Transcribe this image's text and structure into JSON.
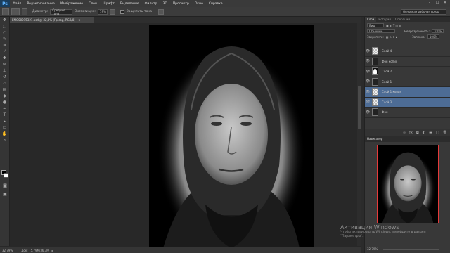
{
  "menubar": {
    "logo": "Ps",
    "items": [
      "Файл",
      "Редактирование",
      "Изображение",
      "Слои",
      "Шрифт",
      "Выделение",
      "Фильтр",
      "3D",
      "Просмотр",
      "Окно",
      "Справка"
    ],
    "controls": [
      "–",
      "☐",
      "✕"
    ]
  },
  "options": {
    "diameter_label": "Диаметр:",
    "smooth_label": "Сглаж.",
    "mode_value": "Средние тона",
    "exposure_label": "Экспозиция:",
    "exposure_value": "19%",
    "protect_label": "Защитить тона",
    "workspace": "Основная рабочая среда"
  },
  "document": {
    "tab_title": "EMG00015321.psd @ 32,8% (Гр.сор, RGB/8)",
    "tab_close": "×"
  },
  "status": {
    "zoom": "32,79%",
    "doc_label": "Док:",
    "doc_size": "5,79M/36,7M"
  },
  "layers": {
    "tabs": [
      "Слои",
      "История",
      "Операции"
    ],
    "kind_label": "Вид",
    "blend_mode": "Обычные",
    "opacity_label": "Непрозрачность:",
    "opacity_value": "100%",
    "lock_label": "Закрепить:",
    "fill_label": "Заливка:",
    "fill_value": "100%",
    "items": [
      {
        "name": "Слой 4",
        "thumb": "checker",
        "selected": false
      },
      {
        "name": "Фон копия",
        "thumb": "dark",
        "selected": false
      },
      {
        "name": "Слой 2",
        "thumb": "mask",
        "selected": false
      },
      {
        "name": "Слой 1",
        "thumb": "dark",
        "selected": false
      },
      {
        "name": "Слой 1 копия",
        "thumb": "checker",
        "selected": true
      },
      {
        "name": "Слой 3",
        "thumb": "checker",
        "selected": true
      },
      {
        "name": "Фон",
        "thumb": "dark",
        "selected": false
      }
    ],
    "footer_icons": [
      "link",
      "fx",
      "mask",
      "adjust",
      "folder",
      "new",
      "trash"
    ]
  },
  "navigator": {
    "title": "Навигатор",
    "zoom": "32,79%",
    "box_color": "#e53a3a"
  },
  "watermark": {
    "title": "Активация Windows",
    "line1": "Чтобы активировать Windows, перейдите в раздел",
    "line2": "\"Параметры\"."
  },
  "colors": {
    "selection": "#4d6c95",
    "ps_blue": "#5fb3ff"
  }
}
